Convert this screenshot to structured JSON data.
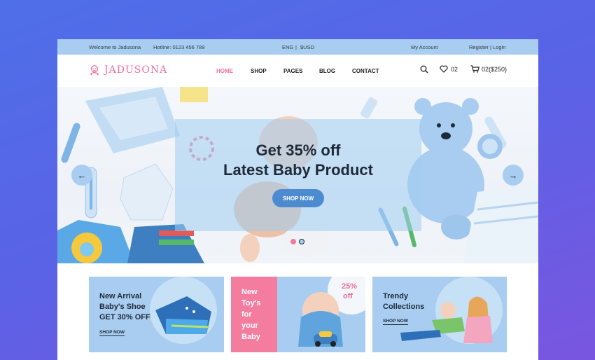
{
  "topbar": {
    "welcome": "Welcome to Jadusona",
    "hotline": "Hotline: 0123 456 789",
    "lang": "ENG",
    "sep": "|",
    "currency": "$USD",
    "account": "My Account",
    "auth": "Register | Login"
  },
  "header": {
    "logo_text": "JADUSONA",
    "nav": [
      "HOME",
      "SHOP",
      "PAGES",
      "BLOG",
      "CONTACT"
    ],
    "wishlist_count": "02",
    "cart_text": "02($250)"
  },
  "hero": {
    "line1": "Get 35% off",
    "line2": "Latest Baby Product",
    "button": "SHOP NOW",
    "prev": "←",
    "next": "→"
  },
  "banners": {
    "left": {
      "l1": "New Arrival",
      "l2": "Baby's Shoe",
      "l3": "GET 30% OFF",
      "shop": "SHOP NOW"
    },
    "mid": {
      "l1": "New",
      "l2": "Toy's",
      "l3": "for",
      "l4": "your",
      "l5": "Baby",
      "pct": "25%",
      "off": "off"
    },
    "right": {
      "l1": "Trendy",
      "l2": "Collections",
      "shop": "SHOP NOW"
    }
  },
  "colors": {
    "accent": "#f0709a",
    "topbar": "#a9cdf0",
    "button": "#4c8bd0"
  }
}
